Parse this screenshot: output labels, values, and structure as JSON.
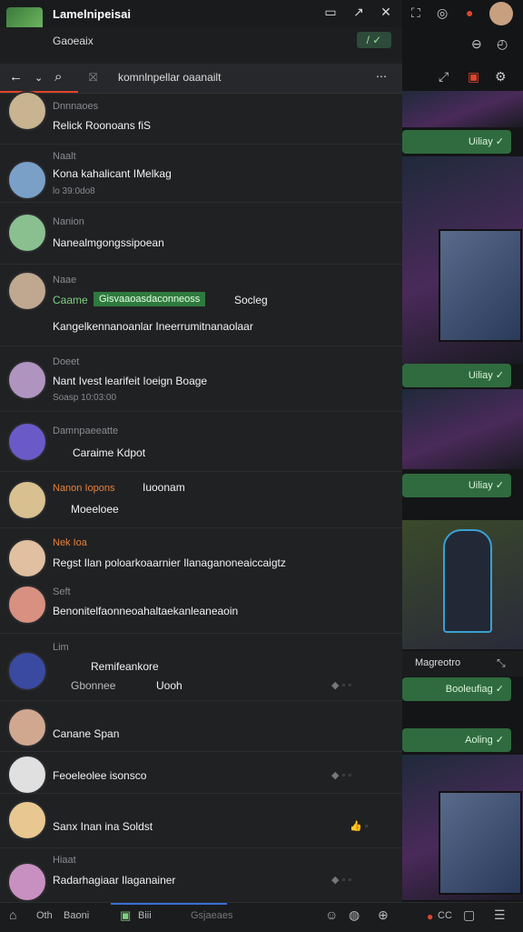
{
  "window": {
    "title": "Lamelnipeisai",
    "status": "Gaoeaix"
  },
  "toolbar": {
    "search_text": "komnlnpellar oaanailt"
  },
  "messages": [
    {
      "name": "Dnnnaoes",
      "text": "Relick Roonoans fiS",
      "time": "",
      "color": "#c8b490"
    },
    {
      "name": "Naalt",
      "text": "Kona kahalicant IMelkag",
      "time": "lo 39:0do8",
      "color": "#7aa0c8"
    },
    {
      "name": "Nanion",
      "text": "Nanealmgongssipoean",
      "time": "",
      "color": "#8ac090"
    },
    {
      "name": "Naae",
      "text": "Kangelkennanoanlar Ineerrumitnanaolaar",
      "time": "",
      "color": "#c0a890",
      "label": "Caame",
      "badge": "Gisvaaoasdaconneoss",
      "badge_tail": "Socleg"
    },
    {
      "name": "Doeet",
      "text": "Nant Ivest learifeit Ioeign Boage",
      "time": "Soasp 10:03:00",
      "color": "#b094c0"
    },
    {
      "name": "Damnpaeeatte",
      "text": "Caraime Kdpot",
      "time": "",
      "color": "#6a5ac8"
    },
    {
      "name": "Nanon Iopons",
      "text": "Moeeloee",
      "time": "",
      "color": "#d8c090",
      "extra": "Iuoonam"
    },
    {
      "name": "Nek Ioa",
      "text": "Regst Ilan poloarkoaarnier Ilanaganoneaiccaigtz",
      "time": "",
      "color": "#e0c0a0"
    },
    {
      "name": "Seft",
      "text": "Benonitelfaonneoahaltaekanleaneaoin",
      "time": "",
      "color": "#d89080"
    },
    {
      "name": "Lim",
      "text": "Uooh",
      "time": "",
      "color": "#3a4aa0",
      "extra": "Remifeankore",
      "extra2": "Gbonnee"
    },
    {
      "name": "",
      "text": "Canane Span",
      "time": "",
      "color": "#d0a890"
    },
    {
      "name": "",
      "text": "Feoeleolee isonsco",
      "time": "",
      "color": "#e0e0e0"
    },
    {
      "name": "",
      "text": "Sanx Inan ina Soldst",
      "time": "",
      "color": "#e8c890"
    },
    {
      "name": "Hiaat",
      "text": "Radarhagiaar Ilaganainer",
      "time": "",
      "color": "#c890c0"
    }
  ],
  "right_buttons": [
    "Uiliay",
    "Uiliay",
    "Uiliay",
    "Booleufiag",
    "Aoling"
  ],
  "right_caption": "Magreotro",
  "footer": {
    "a": "Oth",
    "b": "Baoni",
    "c": "Biii",
    "d": "Gsjaeaes"
  }
}
